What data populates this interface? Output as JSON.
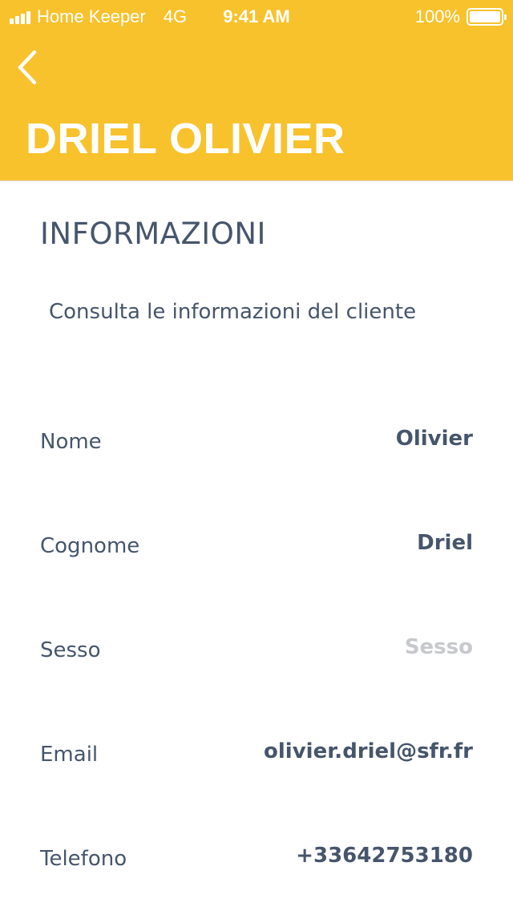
{
  "status_bar": {
    "carrier": "Home Keeper",
    "network": "4G",
    "time": "9:41 AM",
    "battery": "100%",
    "battery_level": 1.0
  },
  "header": {
    "back_icon": "chevron-left-icon",
    "title": "DRIEL OLIVIER",
    "background_color": "#f8c22d"
  },
  "section": {
    "title": "INFORMAZIONI",
    "subtitle": "Consulta le informazioni del cliente"
  },
  "fields": [
    {
      "label": "Nome",
      "value": "Olivier"
    },
    {
      "label": "Cognome",
      "value": "Driel"
    },
    {
      "label": "Sesso",
      "value": "",
      "placeholder": "Sesso"
    },
    {
      "label": "Email",
      "value": "olivier.driel@sfr.fr"
    },
    {
      "label": "Telefono",
      "value": "+33642753180"
    }
  ],
  "colors": {
    "text": "#46556b",
    "placeholder": "#c7c9cc"
  }
}
